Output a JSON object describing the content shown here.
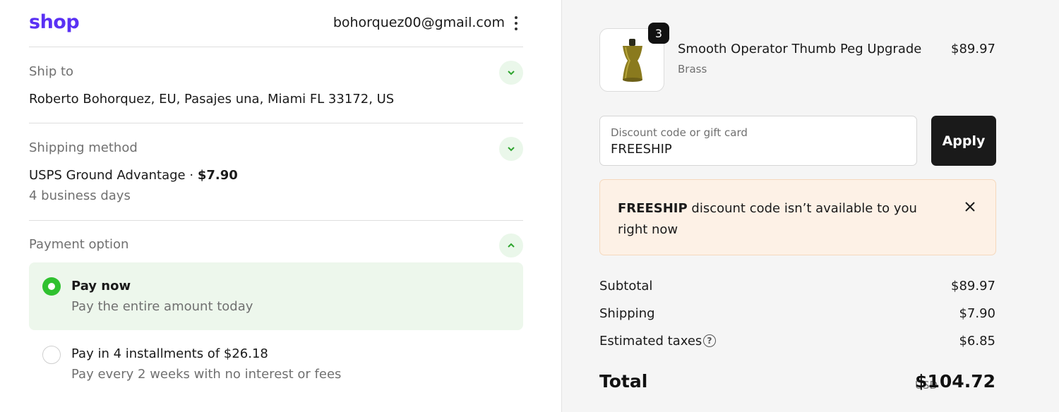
{
  "header": {
    "logo": "shop",
    "account_email": "bohorquez00@gmail.com",
    "menu_icon": "kebab-menu-icon"
  },
  "ship_to": {
    "label": "Ship to",
    "address": "Roberto Bohorquez, EU, Pasajes una, Miami FL 33172, US",
    "toggle_icon": "chevron-down-icon"
  },
  "shipping_method": {
    "label": "Shipping method",
    "method": "USPS Ground Advantage",
    "separator": " · ",
    "price": "$7.90",
    "eta": "4 business days",
    "toggle_icon": "chevron-down-icon"
  },
  "payment_option": {
    "label": "Payment option",
    "toggle_icon": "chevron-up-icon",
    "options": [
      {
        "title": "Pay now",
        "description": "Pay the entire amount today",
        "selected": true
      },
      {
        "title": "Pay in 4 installments of $26.18",
        "description": "Pay every 2 weeks with no interest or fees",
        "selected": false
      }
    ]
  },
  "order": {
    "product": {
      "name": "Smooth Operator Thumb Peg Upgrade",
      "variant": "Brass",
      "price": "$89.97",
      "quantity": "3"
    },
    "discount": {
      "placeholder": "Discount code or gift card",
      "value": "FREESHIP",
      "apply_label": "Apply"
    },
    "alert": {
      "code": "FREESHIP",
      "message": " discount code isn’t available to you right now"
    },
    "summary": {
      "subtotal_label": "Subtotal",
      "subtotal": "$89.97",
      "shipping_label": "Shipping",
      "shipping": "$7.90",
      "taxes_label": "Estimated taxes",
      "taxes": "$6.85",
      "total_label": "Total",
      "currency": "USD",
      "total": "$104.72"
    }
  },
  "colors": {
    "brand": "#5a31f4",
    "accent_green": "#2fc12f",
    "selected_bg": "#edf7ec",
    "alert_bg": "#fdf1e6",
    "button_dark": "#1a1a1a"
  }
}
